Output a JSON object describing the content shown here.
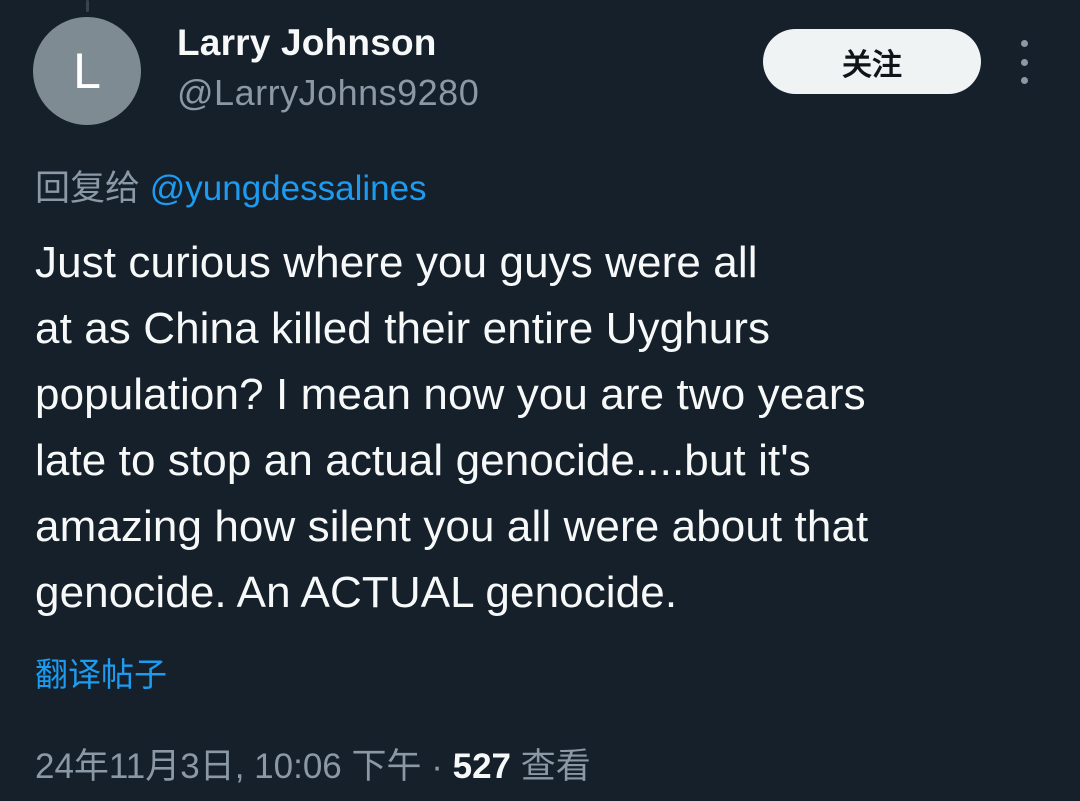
{
  "author": {
    "avatar_letter": "L",
    "display_name": "Larry Johnson",
    "handle": "@LarryJohns9280"
  },
  "header": {
    "follow_label": "关注",
    "more_icon": "more-vertical-icon"
  },
  "reply": {
    "prefix": "回复给",
    "mention": "@yungdessalines"
  },
  "tweet": {
    "text": "Just curious where you guys were all\nat as China killed their entire Uyghurs\npopulation? I mean now you are two years\nlate to stop an actual genocide....but it's\namazing how silent you all were about that\ngenocide. An ACTUAL genocide."
  },
  "translate_label": "翻译帖子",
  "meta": {
    "timestamp": "24年11月3日, 10:06 下午",
    "separator": "·",
    "views_count": "527",
    "views_label": "查看"
  },
  "colors": {
    "background": "#15202b",
    "text_primary": "#f7f9f9",
    "text_secondary": "#8b98a5",
    "accent": "#1d9bf0",
    "avatar_bg": "#7f8b92",
    "button_bg": "#eff3f4"
  }
}
